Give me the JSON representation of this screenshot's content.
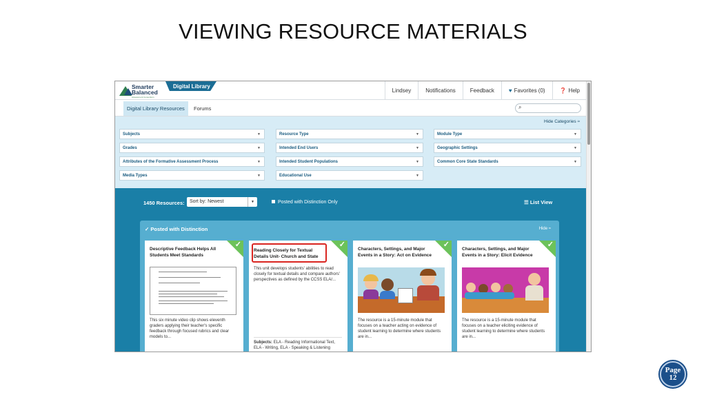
{
  "slide": {
    "title": "VIEWING RESOURCE MATERIALS",
    "page_label": "Page",
    "page_number": "12"
  },
  "logo": {
    "line1": "Smarter",
    "line2": "Balanced",
    "line3": "Assessment Consortium"
  },
  "app": {
    "library_tab": "Digital Library"
  },
  "topnav": {
    "user": "Lindsey",
    "notifications": "Notifications",
    "feedback": "Feedback",
    "favorites": "Favorites (0)",
    "help": "Help"
  },
  "subnav": {
    "tabs": [
      "Digital Library Resources",
      "Forums"
    ],
    "search_placeholder": ""
  },
  "filters": {
    "hide_categories": "Hide Categories",
    "col1": [
      "Subjects",
      "Grades",
      "Attributes of the Formative Assessment Process",
      "Media Types"
    ],
    "col2": [
      "Resource Type",
      "Intended End Users",
      "Intended Student Populations",
      "Educational Use"
    ],
    "col3": [
      "Module Type",
      "Geographic Settings",
      "Common Core State Standards"
    ]
  },
  "results": {
    "count": "1450 Resources:",
    "sort_value": "Sort by: Newest",
    "posted_only": "Posted with Distinction Only",
    "list_view": "List View"
  },
  "panel": {
    "title": "Posted with Distinction",
    "hide": "Hide"
  },
  "cards": [
    {
      "title": "Descriptive Feedback Helps All Students Meet Standards",
      "desc": "This six minute video clip shows eleventh graders applying their teacher's specific feedback through focused rubrics and clear models to..."
    },
    {
      "title": "Reading Closely for Textual Details Unit- Church and State",
      "desc": "This unit develops students' abilities to read closely for textual details and compare authors' perspectives as defined by the CCSS ELA/...",
      "subjects_label": "Subjects:",
      "subjects": "ELA - Reading Informational Text, ELA - Writing, ELA - Speaking & Listening"
    },
    {
      "title": "Characters, Settings, and Major Events in a Story: Act on Evidence",
      "desc": "The resource is a 15-minute module that focuses on a teacher acting on evidence of student learning to determine where students are in..."
    },
    {
      "title": "Characters, Settings, and Major Events in a Story: Elicit Evidence",
      "desc": "The resource is a 15-minute module that focuses on a teacher eliciting evidence of student learning to determine where students are in..."
    }
  ],
  "colors": {
    "brand_blue": "#1a7fa7",
    "filter_bg": "#d7ecf6",
    "distinction_green": "#6cc25a",
    "highlight_red": "#d9241f"
  }
}
